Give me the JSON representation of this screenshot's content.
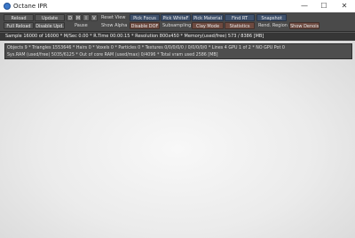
{
  "window": {
    "title": "Octane IPR",
    "minimize": "—",
    "maximize": "☐",
    "close": "✕"
  },
  "toolbar": {
    "row1": {
      "reload": "Reload",
      "update": "Update",
      "d": "D",
      "m": "M",
      "i": "I",
      "v": "V",
      "reset_view": "Reset View",
      "pick_focus": "Pick Focus",
      "pick_whitef": "Pick WhiteF",
      "pick_material": "Pick Material",
      "find_rt": "Find RT",
      "snapshot": "Snapshot"
    },
    "row2": {
      "full_reload": "Full Reload",
      "disable_upd": "Disable Upd.",
      "pause": "Pause",
      "show_alpha": "Show Alpha",
      "disable_dof": "Disable DOF",
      "subsampling": "Subsampling",
      "clay_mode": "Clay Mode",
      "statistics": "Statistics",
      "rend_region": "Rend. Region",
      "show_denoise": "Show Denoise"
    }
  },
  "status": {
    "text": "Sample 16000 of 16000 * M/Sec 0.00 * R.Time 00:00:15 * Resolution 800x450 * Memory(used/free) 573 / 8386 [MB]"
  },
  "info": {
    "line1": "Objects 9 * Triangles 1553646 * Hairs 0 * Voxels 0 * Particles 0 * Textures 0/0/0/0/0 / 0/0/0/0/0 * Lines 4 GPU 1 of 2 * NO GPU Pot 0",
    "line2": "Sys.RAM (used/free) 5035/6125 * Out of core RAM (used/max) 0/4096 * Total vram used 2586 [MB]"
  },
  "colors": {
    "toolbar_bg": "#4a4a4a",
    "button_blue": "#40526d",
    "button_brown": "#6e4b41",
    "status_bg": "#363636",
    "render_bg": "#ebebeb"
  }
}
